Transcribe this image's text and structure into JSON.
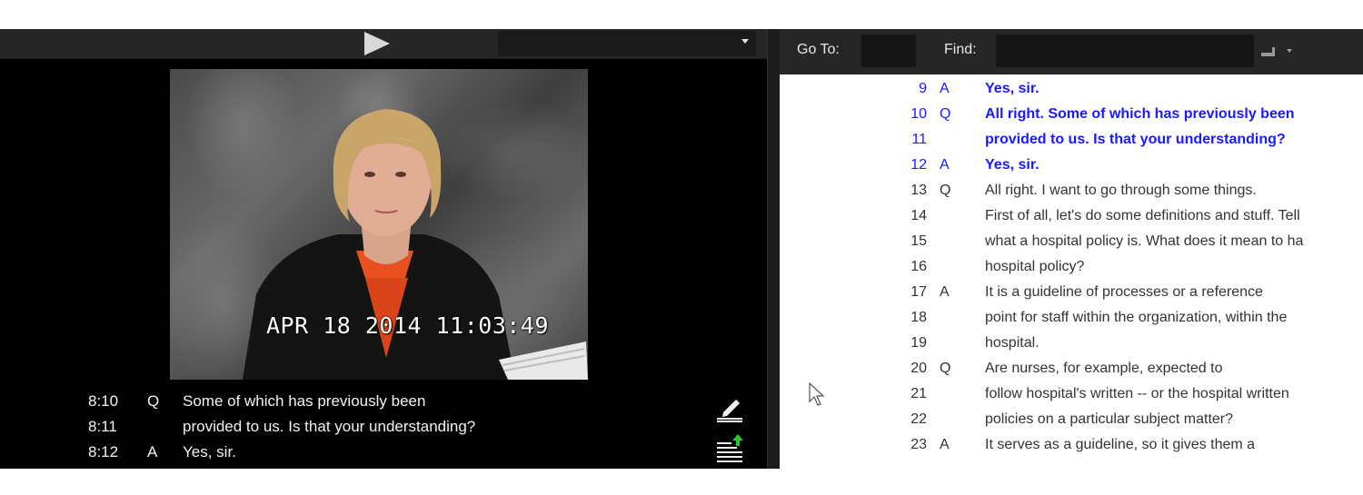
{
  "video_panel": {
    "timestamp": "APR 18 2014 11:03:49",
    "captions": [
      {
        "ref": "8:10",
        "speaker": "Q",
        "text": "Some of which has previously been"
      },
      {
        "ref": "8:11",
        "speaker": "",
        "text": "provided to us.  Is that your understanding?"
      },
      {
        "ref": "8:12",
        "speaker": "A",
        "text": "Yes, sir."
      }
    ]
  },
  "transcript_panel": {
    "goto_label": "Go To:",
    "goto_value": "",
    "find_label": "Find:",
    "find_value": "",
    "highlight_color": "#1a1aff",
    "lines": [
      {
        "num": "9",
        "speaker": "A",
        "text": "Yes, sir.",
        "highlighted": true
      },
      {
        "num": "10",
        "speaker": "Q",
        "text": "All right.  Some of which has previously been",
        "highlighted": true
      },
      {
        "num": "11",
        "speaker": "",
        "text": "provided to us.  Is that your understanding?",
        "highlighted": true
      },
      {
        "num": "12",
        "speaker": "A",
        "text": "Yes, sir.",
        "highlighted": true
      },
      {
        "num": "13",
        "speaker": "Q",
        "text": "All right.  I want to go through some things.",
        "highlighted": false
      },
      {
        "num": "14",
        "speaker": "",
        "text": "First of all, let's do some definitions and stuff.  Tell",
        "highlighted": false
      },
      {
        "num": "15",
        "speaker": "",
        "text": "what a hospital policy is.  What does it mean to ha",
        "highlighted": false
      },
      {
        "num": "16",
        "speaker": "",
        "text": "hospital policy?",
        "highlighted": false
      },
      {
        "num": "17",
        "speaker": "A",
        "text": "It is a guideline of processes or a reference",
        "highlighted": false
      },
      {
        "num": "18",
        "speaker": "",
        "text": "point for staff within the organization, within the",
        "highlighted": false
      },
      {
        "num": "19",
        "speaker": "",
        "text": "hospital.",
        "highlighted": false
      },
      {
        "num": "20",
        "speaker": "Q",
        "text": "Are nurses, for example, expected to",
        "highlighted": false
      },
      {
        "num": "21",
        "speaker": "",
        "text": "follow hospital's written -- or the hospital written",
        "highlighted": false
      },
      {
        "num": "22",
        "speaker": "",
        "text": "policies on a particular subject matter?",
        "highlighted": false
      },
      {
        "num": "23",
        "speaker": "A",
        "text": "It serves as a guideline, so it gives them a",
        "highlighted": false
      }
    ]
  },
  "icons": {
    "play": "play-icon",
    "dropdown": "chevron-down-icon",
    "annotate": "pen-icon",
    "export": "export-icon",
    "find_options": "find-options-icon",
    "cursor": "mouse-cursor-icon"
  }
}
